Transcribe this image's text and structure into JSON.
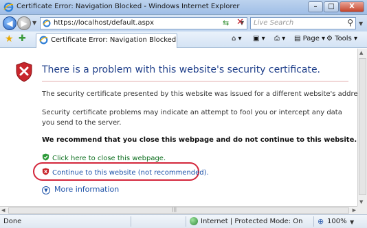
{
  "window": {
    "title": "Certificate Error: Navigation Blocked - Windows Internet Explorer",
    "buttons": {
      "minimize": "–",
      "maximize": "□",
      "close": "X"
    }
  },
  "address_bar": {
    "url": "https://localhost/default.aspx",
    "search_placeholder": "Live Search"
  },
  "tab": {
    "label": "Certificate Error: Navigation Blocked"
  },
  "command_bar": {
    "page_label": "Page",
    "tools_label": "Tools"
  },
  "content": {
    "headline": "There is a problem with this website's security certificate.",
    "paragraph1": "The security certificate presented by this website was issued for a different website's address.",
    "paragraph2": "Security certificate problems may indicate an attempt to fool you or intercept any data you send to the server.",
    "recommendation": "We recommend that you close this webpage and do not continue to this website.",
    "close_link": "Click here to close this webpage.",
    "continue_link": "Continue to this website (not recommended).",
    "more_info": "More information"
  },
  "status_bar": {
    "status": "Done",
    "zone": "Internet | Protected Mode: On",
    "zoom": "100%"
  },
  "colors": {
    "headline": "#1f3f8a",
    "close_link": "#0c6e1e",
    "continue_link": "#1d52a8",
    "highlight": "#d3253a"
  }
}
